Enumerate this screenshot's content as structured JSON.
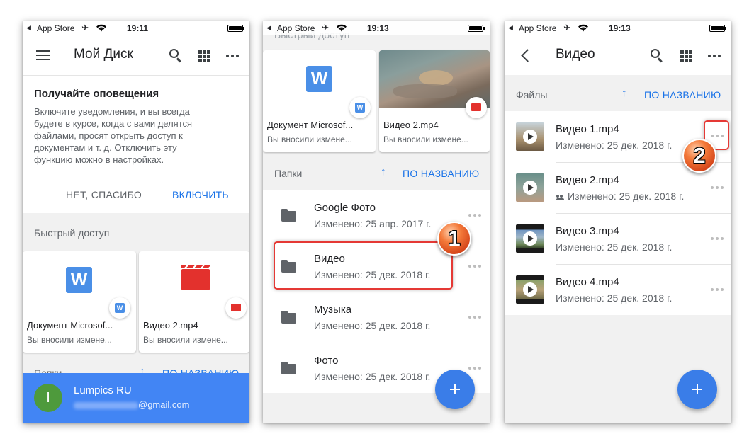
{
  "status_bar": {
    "back_app": "App Store",
    "time_p1": "19:11",
    "time_p2": "19:13",
    "time_p3": "19:13"
  },
  "phone1": {
    "title": "Мой Диск",
    "notification": {
      "title": "Получайте оповещения",
      "lines": [
        "Включите уведомления, и вы всегда",
        "будете в курсе, когда с вами делятся",
        "файлами, просят открыть доступ к",
        "документам и т. д. Отключить эту",
        "функцию можно в настройках."
      ],
      "dismiss": "НЕТ, СПАСИБО",
      "enable": "ВКЛЮЧИТЬ"
    },
    "quick_access_label": "Быстрый доступ",
    "cards": [
      {
        "name": "Документ Microsof...",
        "sub": "Вы вносили измене..."
      },
      {
        "name": "Видео 2.mp4",
        "sub": "Вы вносили измене..."
      }
    ],
    "folders_label": "Папки",
    "sort_label": "ПО НАЗВАНИЮ",
    "account": {
      "initial": "I",
      "name": "Lumpics RU",
      "email": "@gmail.com"
    }
  },
  "phone2": {
    "quick_access_label": "Быстрый доступ",
    "cards": [
      {
        "name": "Документ Microsof...",
        "sub": "Вы вносили измене..."
      },
      {
        "name": "Видео 2.mp4",
        "sub": "Вы вносили измене..."
      }
    ],
    "folders_label": "Папки",
    "sort_label": "ПО НАЗВАНИЮ",
    "folders": [
      {
        "name": "Google Фото",
        "modified": "Изменено: 25 апр. 2017 г."
      },
      {
        "name": "Видео",
        "modified": "Изменено: 25 дек. 2018 г."
      },
      {
        "name": "Музыка",
        "modified": "Изменено: 25 дек. 2018 г."
      },
      {
        "name": "Фото",
        "modified": "Изменено: 25 дек. 2018 г."
      }
    ],
    "callout_number": "1"
  },
  "phone3": {
    "title": "Видео",
    "files_label": "Файлы",
    "sort_label": "ПО НАЗВАНИЮ",
    "files": [
      {
        "name": "Видео 1.mp4",
        "modified": "Изменено: 25 дек. 2018 г.",
        "shared": false
      },
      {
        "name": "Видео 2.mp4",
        "modified": "Изменено: 25 дек. 2018 г.",
        "shared": true
      },
      {
        "name": "Видео 3.mp4",
        "modified": "Изменено: 25 дек. 2018 г.",
        "shared": false
      },
      {
        "name": "Видео 4.mp4",
        "modified": "Изменено: 25 дек. 2018 г.",
        "shared": false
      }
    ],
    "callout_number": "2"
  },
  "icons": {
    "menu": "hamburger-menu-icon",
    "search": "search-icon",
    "grid": "grid-view-icon",
    "more": "more-horizontal-icon",
    "back": "chevron-left-icon",
    "folder": "folder-icon",
    "play": "play-icon",
    "add": "plus-icon",
    "shared": "people-icon"
  },
  "colors": {
    "accent": "#1a73e8",
    "fab": "#3a7de8",
    "account_bar": "#4285f4",
    "avatar": "#4e9a3c",
    "word": "#4a8fe7",
    "video": "#e3312d",
    "callout": "#e53935"
  }
}
